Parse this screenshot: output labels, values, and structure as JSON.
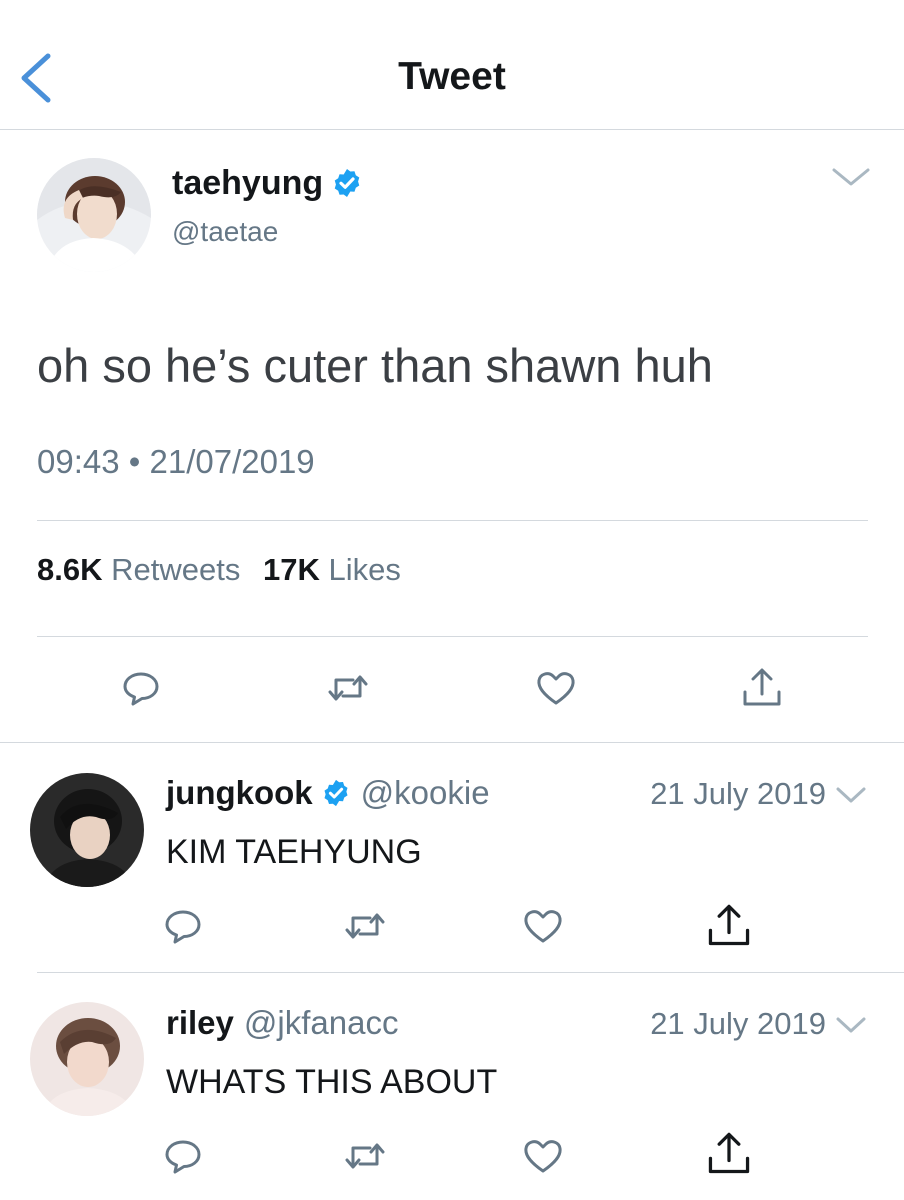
{
  "header": {
    "title": "Tweet",
    "back_icon": "chevron-left-icon"
  },
  "tweet": {
    "author_name": "taehyung",
    "author_handle": "@taetae",
    "verified": true,
    "text": "oh so he’s cuter than shawn huh",
    "time": "09:43",
    "separator": "•",
    "date": "21/07/2019",
    "retweets_count": "8.6K",
    "retweets_label": "Retweets",
    "likes_count": "17K",
    "likes_label": "Likes"
  },
  "replies": [
    {
      "name": "jungkook",
      "handle": "@kookie",
      "verified": true,
      "date": "21 July 2019",
      "text": "KIM TAEHYUNG"
    },
    {
      "name": "riley",
      "handle": "@jkfanacc",
      "verified": false,
      "date": "21 July 2019",
      "text": "WHATS THIS ABOUT"
    }
  ],
  "colors": {
    "accent": "#4a90d9",
    "verified": "#1da1f2",
    "secondary_text": "#657786",
    "divider": "#d4d9de",
    "icon": "#657786"
  }
}
